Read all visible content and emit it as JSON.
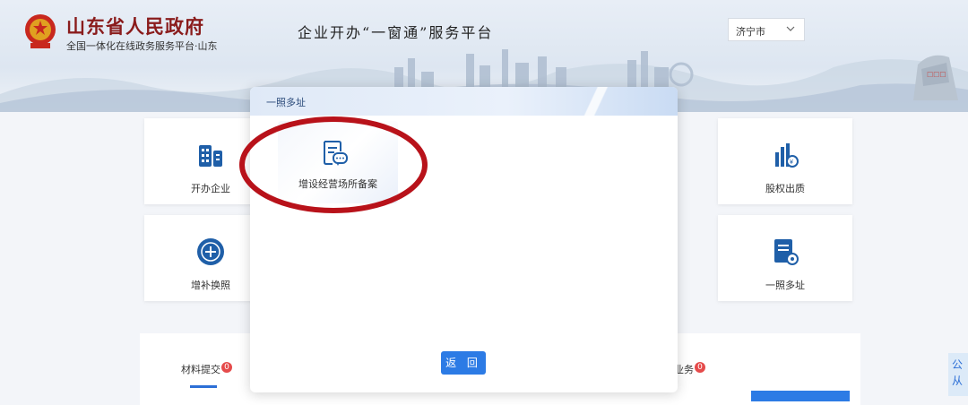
{
  "header": {
    "gov_title": "山东省人民政府",
    "gov_subtitle": "全国一体化在线政务服务平台·山东",
    "platform_title": "企业开办“一窗通”服务平台",
    "city_select": {
      "value": "济宁市",
      "icon": "chevron-down-icon"
    }
  },
  "cards": [
    {
      "label": "开办企业",
      "icon": "building-icon"
    },
    {
      "label": "股权出质",
      "icon": "chart-bars-icon"
    },
    {
      "label": "增补换照",
      "icon": "plus-circle-icon"
    },
    {
      "label": "一照多址",
      "icon": "doc-gear-icon"
    }
  ],
  "bottom": {
    "tab_left": "材料提交",
    "tab_left_badge": "0",
    "tab_right": "业务",
    "tab_right_badge": "0"
  },
  "side_float": {
    "line1": "公",
    "line2": "从"
  },
  "modal": {
    "title": "一照多址",
    "service": {
      "label": "增设经营场所备案",
      "icon": "document-chat-icon"
    },
    "back_button": "返 回"
  },
  "colors": {
    "accent": "#2c7be5",
    "gov_red": "#8a1c1c",
    "annotation": "#b8121a",
    "badge": "#e54b4b"
  }
}
